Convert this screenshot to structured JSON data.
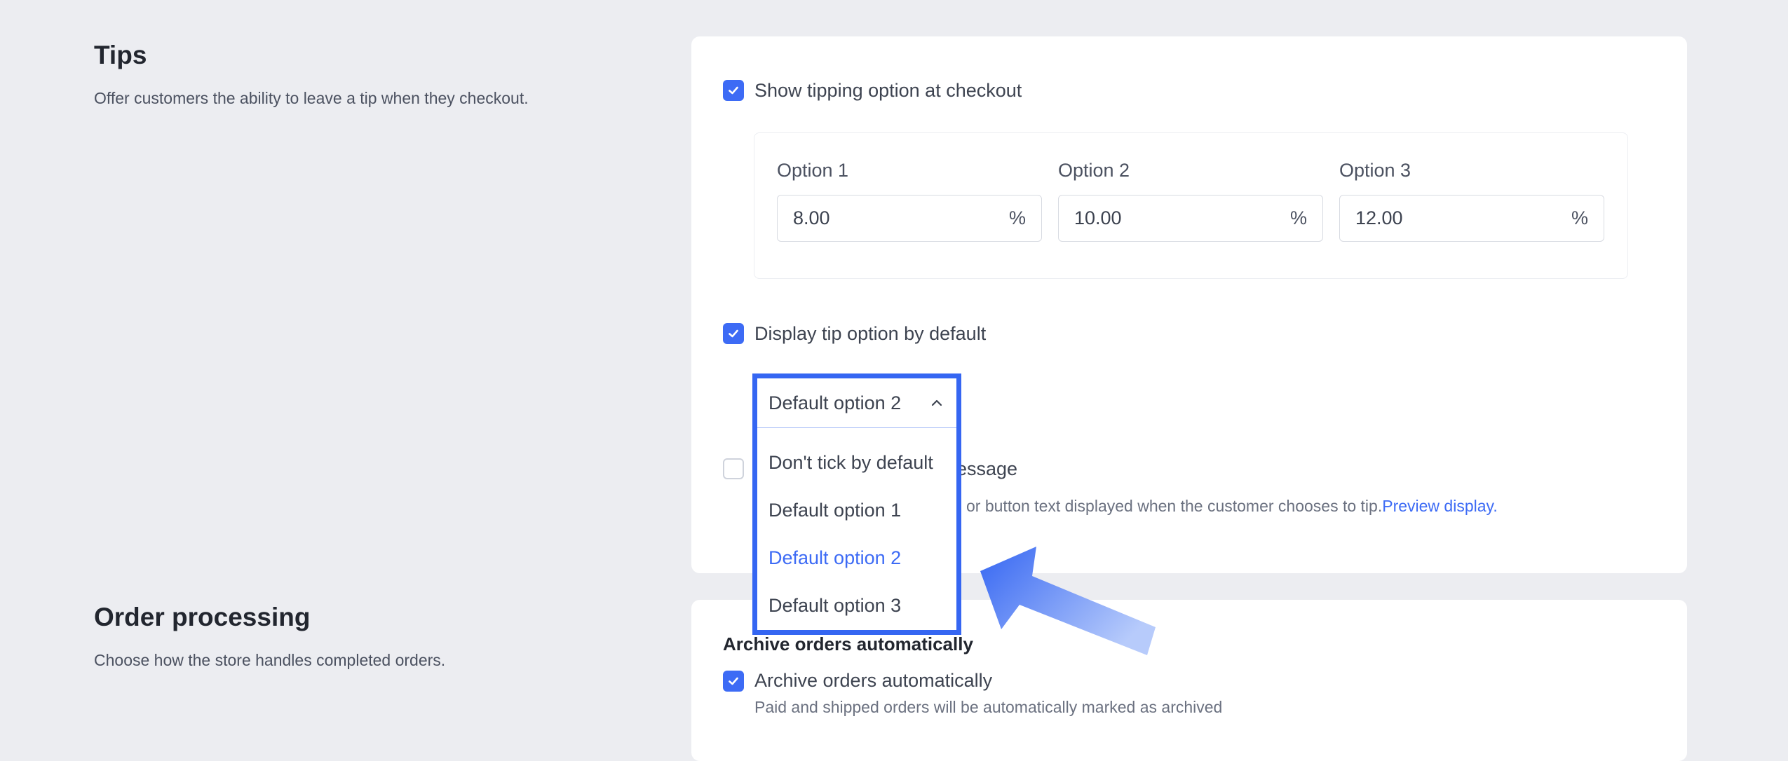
{
  "tips": {
    "title": "Tips",
    "description": "Offer customers the ability to leave a tip when they checkout.",
    "show_tipping_label": "Show tipping option at checkout",
    "show_tipping_checked": true,
    "options": [
      {
        "label": "Option 1",
        "value": "8.00",
        "unit": "%"
      },
      {
        "label": "Option 2",
        "value": "10.00",
        "unit": "%"
      },
      {
        "label": "Option 3",
        "value": "12.00",
        "unit": "%"
      }
    ],
    "display_default_label": "Display tip option by default",
    "display_default_checked": true,
    "default_select": {
      "selected": "Default option 2",
      "options": [
        "Don't tick by default",
        "Default option 1",
        "Default option 2",
        "Default option 3"
      ]
    },
    "custom_message_label_partial": "essage",
    "custom_message_checked": false,
    "custom_message_help_partial": "or button text displayed when the customer chooses to tip.",
    "preview_link": "Preview display."
  },
  "order_processing": {
    "title": "Order processing",
    "description": "Choose how the store handles completed orders.",
    "archive_heading": "Archive orders automatically",
    "archive_label": "Archive orders automatically",
    "archive_checked": true,
    "archive_help": "Paid and shipped orders will be automatically marked as archived"
  },
  "colors": {
    "accent": "#3d6bf5",
    "highlight_border": "#3566f2",
    "background": "#ecedf1"
  }
}
